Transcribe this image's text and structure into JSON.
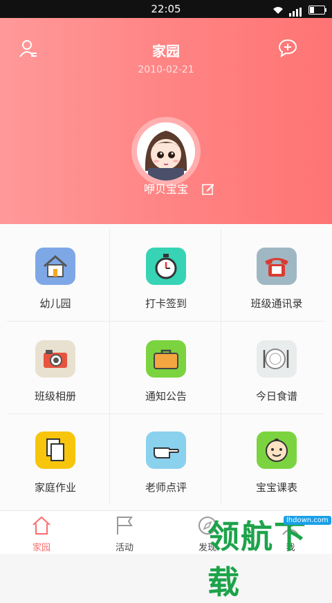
{
  "status_bar": {
    "time": "22:05"
  },
  "header": {
    "title": "家园",
    "date": "2010-02-21",
    "baby_name": "咿贝宝宝"
  },
  "grid": [
    {
      "label": "幼儿园",
      "icon": "house-icon",
      "color": "#7ea7e6"
    },
    {
      "label": "打卡签到",
      "icon": "stopwatch-icon",
      "color": "#36d3b5"
    },
    {
      "label": "班级通讯录",
      "icon": "telephone-icon",
      "color": "#9fb7c3"
    },
    {
      "label": "班级相册",
      "icon": "camera-icon",
      "color": "#e9e1cf"
    },
    {
      "label": "通知公告",
      "icon": "briefcase-icon",
      "color": "#7bd43f"
    },
    {
      "label": "今日食谱",
      "icon": "plate-icon",
      "color": "#e9ecec"
    },
    {
      "label": "家庭作业",
      "icon": "documents-icon",
      "color": "#f6c50c"
    },
    {
      "label": "老师点评",
      "icon": "pointing-hand-icon",
      "color": "#8ad1ee"
    },
    {
      "label": "宝宝课表",
      "icon": "baby-face-icon",
      "color": "#7bd43f"
    }
  ],
  "tabs": [
    {
      "label": "家园",
      "icon": "home-tab-icon",
      "active": true
    },
    {
      "label": "活动",
      "icon": "flag-tab-icon",
      "active": false
    },
    {
      "label": "发现",
      "icon": "discover-tab-icon",
      "active": false
    },
    {
      "label": "我",
      "icon": "me-tab-icon",
      "active": false
    }
  ],
  "watermark": {
    "text": "领航下载",
    "url": "lhdown.com"
  },
  "colors": {
    "accent": "#ff6b6b",
    "header_start": "#ff9999",
    "header_end": "#ff7474"
  }
}
